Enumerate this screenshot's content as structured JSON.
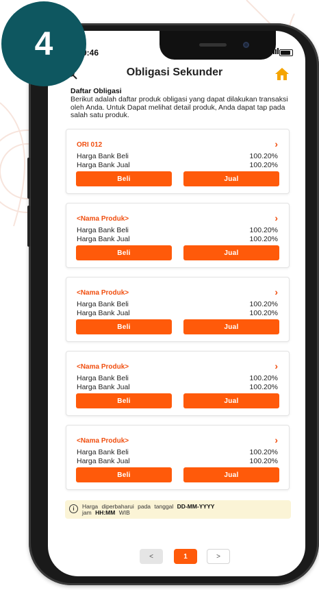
{
  "step_number": "4",
  "status_bar": {
    "time": "9:46"
  },
  "header": {
    "title": "Obligasi Sekunder"
  },
  "intro": {
    "title": "Daftar Obligasi",
    "description": "Berikut adalah daftar produk obligasi yang dapat dilakukan transaksi oleh Anda. Untuk Dapat melihat detail produk, Anda dapat tap pada salah satu produk."
  },
  "products": [
    {
      "name": "ORI 012",
      "buy_label": "Harga Bank  Beli",
      "buy_value": "100.20%",
      "sell_label": "Harga Bank Jual",
      "sell_value": "100.20%",
      "buy_button": "Beli",
      "sell_button": "Jual"
    },
    {
      "name": "<Nama Produk>",
      "buy_label": "Harga Bank  Beli",
      "buy_value": "100.20%",
      "sell_label": "Harga Bank Jual",
      "sell_value": "100.20%",
      "buy_button": "Beli",
      "sell_button": "Jual"
    },
    {
      "name": "<Nama Produk>",
      "buy_label": "Harga Bank  Beli",
      "buy_value": "100.20%",
      "sell_label": "Harga Bank Jual",
      "sell_value": "100.20%",
      "buy_button": "Beli",
      "sell_button": "Jual"
    },
    {
      "name": "<Nama Produk>",
      "buy_label": "Harga Bank  Beli",
      "buy_value": "100.20%",
      "sell_label": "Harga Bank Jual",
      "sell_value": "100.20%",
      "buy_button": "Beli",
      "sell_button": "Jual"
    },
    {
      "name": "<Nama Produk>",
      "buy_label": "Harga Bank  Beli",
      "buy_value": "100.20%",
      "sell_label": "Harga Bank Jual",
      "sell_value": "100.20%",
      "buy_button": "Beli",
      "sell_button": "Jual"
    }
  ],
  "notice": {
    "text_prefix": "Harga diperbaharui pada tanggal",
    "date": "DD-MM-YYYY",
    "text_mid": "jam",
    "time": "HH:MM",
    "timezone": "WIB"
  },
  "pagination": {
    "prev": "<",
    "current": "1",
    "next": ">"
  },
  "colors": {
    "accent": "#ff5a0a",
    "badge": "#0e5760",
    "notice_bg": "#fbf4d6"
  },
  "icons": {
    "back": "search-icon",
    "home": "home-icon",
    "info": "info-icon",
    "chevron": "chevron-right-icon"
  }
}
